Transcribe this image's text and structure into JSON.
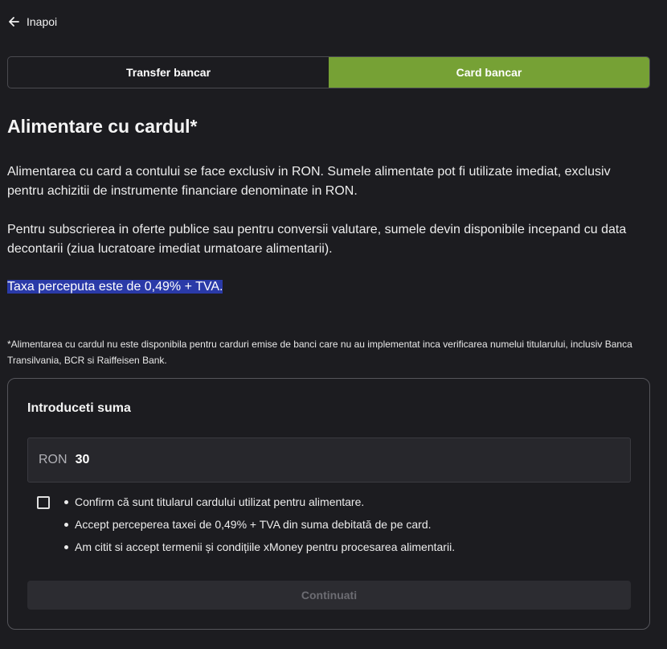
{
  "back": {
    "label": "Inapoi",
    "icon": "arrow-left-icon"
  },
  "tabs": [
    {
      "label": "Transfer bancar",
      "active": false
    },
    {
      "label": "Card bancar",
      "active": true
    }
  ],
  "heading": "Alimentare cu cardul*",
  "info": {
    "p1": "Alimentarea cu card a contului se face exclusiv in RON. Sumele alimentate pot fi utilizate imediat, exclusiv pentru achizitii de instrumente financiare denominate in RON.",
    "p2": "Pentru subscrierea in oferte publice sau pentru conversii valutare, sumele devin disponibile incepand cu data decontarii (ziua lucratoare imediat urmatoare alimentarii).",
    "fee": "Taxa perceputa este de 0,49% + TVA.",
    "note": "*Alimentarea cu cardul nu este disponibila pentru carduri emise de banci care nu au implementat inca verificarea numelui titularului, inclusiv Banca Transilvania, BCR si Raiffeisen Bank."
  },
  "form": {
    "title": "Introduceti suma",
    "currency": "RON",
    "amount": "30",
    "checkbox_checked": false,
    "terms": [
      "Confirm că sunt titularul cardului utilizat pentru alimentare.",
      "Accept perceperea taxei de 0,49% + TVA din suma debitată de pe card.",
      "Am citit si accept termenii și condițiile xMoney pentru procesarea alimentarii."
    ],
    "submit_label": "Continuati",
    "submit_disabled": true
  },
  "colors": {
    "background": "#1c1c20",
    "accent": "#76a135",
    "highlight": "#2a3aa8"
  }
}
